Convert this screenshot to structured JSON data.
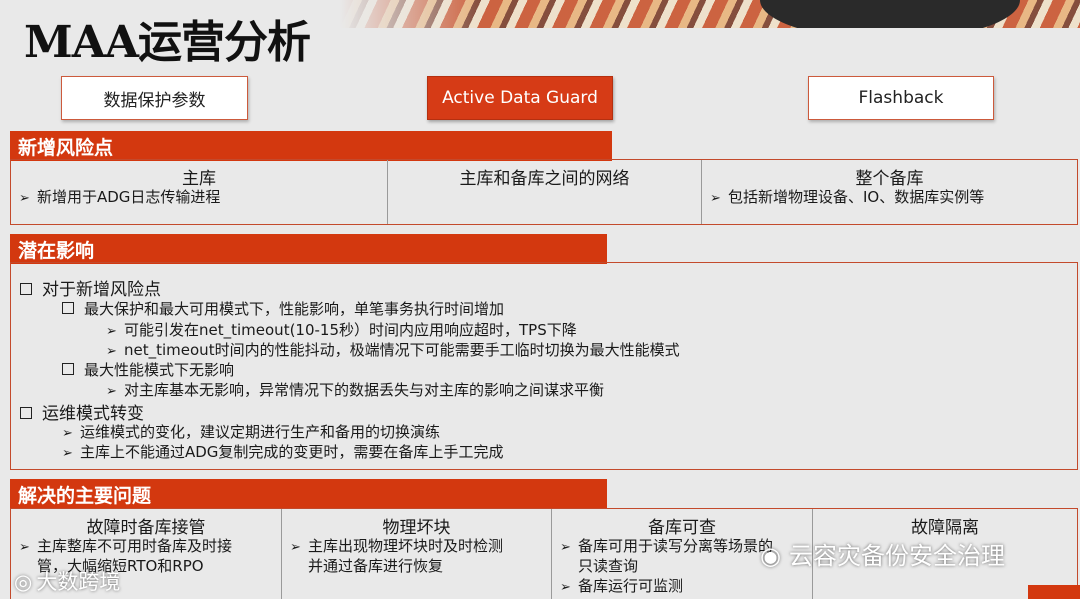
{
  "title": "MAA运营分析",
  "tabs": [
    {
      "label": "数据保护参数",
      "active": false
    },
    {
      "label": "Active Data Guard",
      "active": true
    },
    {
      "label": "Flashback",
      "active": false
    }
  ],
  "colors": {
    "accent": "#d3380f",
    "border": "#c34a2c"
  },
  "risk": {
    "header": "新增风险点",
    "columns": [
      {
        "title": "主库",
        "bullet": "新增用于ADG日志传输进程"
      },
      {
        "title": "主库和备库之间的网络",
        "bullet": ""
      },
      {
        "title": "整个备库",
        "bullet": "包括新增物理设备、IO、数据库实例等"
      }
    ]
  },
  "impact": {
    "header": "潜在影响",
    "lines": [
      "对于新增风险点",
      "最大保护和最大可用模式下，性能影响，单笔事务执行时间增加",
      "可能引发在net_timeout(10-15秒）时间内应用响应超时，TPS下降",
      "net_timeout时间内的性能抖动，极端情况下可能需要手工临时切换为最大性能模式",
      "最大性能模式下无影响",
      "对主库基本无影响，异常情况下的数据丢失与对主库的影响之间谋求平衡",
      "运维模式转变",
      "运维模式的变化，建议定期进行生产和备用的切换演练",
      "主库上不能通过ADG复制完成的变更时，需要在备库上手工完成"
    ]
  },
  "solve": {
    "header": "解决的主要问题",
    "columns": [
      {
        "title": "故障时备库接管",
        "lines": [
          "主库整库不可用时备库及时接",
          "管，大幅缩短RTO和RPO"
        ]
      },
      {
        "title": "物理坏块",
        "lines": [
          "主库出现物理坏块时及时检测",
          "并通过备库进行恢复"
        ]
      },
      {
        "title": "备库可查",
        "lines": [
          "备库可用于读写分离等场景的",
          "只读查询",
          "备库运行可监测"
        ]
      },
      {
        "title": "故障隔离",
        "lines": []
      }
    ]
  },
  "watermarks": {
    "left": "大数跨境",
    "right": "云容灾备份安全治理"
  }
}
